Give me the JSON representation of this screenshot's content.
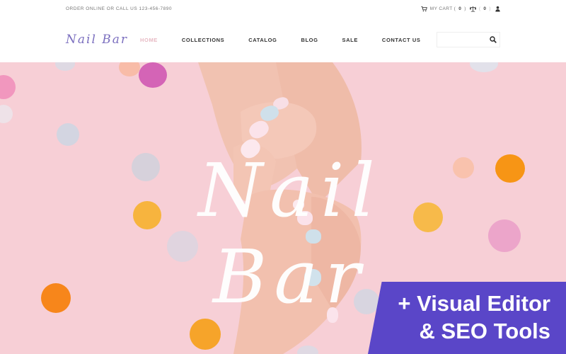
{
  "topbar": {
    "order_text": "ORDER ONLINE OR CALL US 123-456-7890",
    "cart_label": "MY CART (",
    "cart_count": "0",
    "cart_close": ")",
    "compare_count": "0",
    "cart_icon": "cart-icon",
    "compare_icon": "scale-icon",
    "user_icon": "user-icon"
  },
  "header": {
    "logo": "Nail Bar",
    "nav": [
      {
        "label": "HOME",
        "active": true
      },
      {
        "label": "COLLECTIONS"
      },
      {
        "label": "CATALOG"
      },
      {
        "label": "BLOG"
      },
      {
        "label": "SALE"
      },
      {
        "label": "CONTACT US"
      }
    ],
    "search": {
      "placeholder": "",
      "icon": "search-icon"
    }
  },
  "hero": {
    "title": "Nail Bar",
    "background": "#f7cfd6"
  },
  "promo": {
    "line1": "+ Visual Editor",
    "line2": "& SEO Tools",
    "color": "#5a46c8"
  },
  "colors": {
    "accent": "#7b6fbf",
    "nav_active": "#e7b9c3"
  }
}
